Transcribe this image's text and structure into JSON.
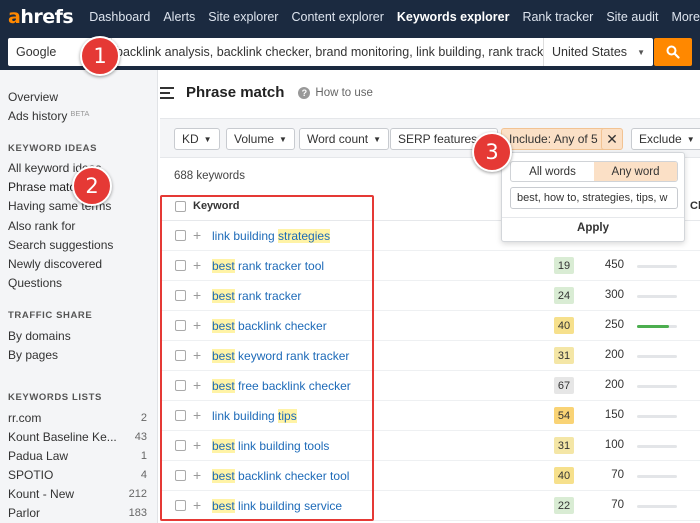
{
  "app": {
    "logo_a": "a",
    "logo_rest": "hrefs"
  },
  "nav": {
    "items": [
      "Dashboard",
      "Alerts",
      "Site explorer",
      "Content explorer",
      "Keywords explorer",
      "Rank tracker",
      "Site audit",
      "More"
    ],
    "active": "Keywords explorer"
  },
  "search": {
    "engine": "Google",
    "query": "backlink analysis, backlink checker, brand monitoring, link building, rank tracker, site au",
    "country": "United States",
    "button_icon": "search-icon"
  },
  "sidebar": {
    "top_items": [
      "Overview",
      "Ads history"
    ],
    "beta_label": "BETA",
    "keyword_ideas_heading": "KEYWORD IDEAS",
    "keyword_ideas": [
      "All keyword ideas",
      "Phrase match",
      "Having same terms",
      "Also rank for",
      "Search suggestions",
      "Newly discovered",
      "Questions"
    ],
    "traffic_share_heading": "TRAFFIC SHARE",
    "traffic_share": [
      "By domains",
      "By pages"
    ],
    "keywords_lists_heading": "KEYWORDS LISTS",
    "keywords_lists": [
      {
        "name": "rr.com",
        "count": "2"
      },
      {
        "name": "Kount Baseline Ke...",
        "count": "43"
      },
      {
        "name": "Padua Law",
        "count": "1"
      },
      {
        "name": "SPOTIO",
        "count": "4"
      },
      {
        "name": "Kount - New",
        "count": "212"
      },
      {
        "name": "Parlor",
        "count": "183"
      }
    ]
  },
  "page": {
    "title": "Phrase match",
    "how_to": "How to use"
  },
  "filters": {
    "kd": "KD",
    "volume": "Volume",
    "word_count": "Word count",
    "serp": "SERP features",
    "include": "Include: Any of 5",
    "include_clear": "✕",
    "exclude": "Exclude"
  },
  "keyword_count": "688 keywords",
  "table": {
    "keyword_header": "Keyword",
    "cl_header": "Cl",
    "rows": [
      {
        "pre": "",
        "hl": "",
        "mid": "link building ",
        "hl2": "strategies",
        "kd": "",
        "volume": "",
        "trend": 0
      },
      {
        "pre": "",
        "hl": "best",
        "mid": " rank tracker tool",
        "hl2": "",
        "kd": "19",
        "volume": "450",
        "trend": 0
      },
      {
        "pre": "",
        "hl": "best",
        "mid": " rank tracker",
        "hl2": "",
        "kd": "24",
        "volume": "300",
        "trend": 0
      },
      {
        "pre": "",
        "hl": "best",
        "mid": " backlink checker",
        "hl2": "",
        "kd": "40",
        "volume": "250",
        "trend": 0.8
      },
      {
        "pre": "",
        "hl": "best",
        "mid": " keyword rank tracker",
        "hl2": "",
        "kd": "31",
        "volume": "200",
        "trend": 0
      },
      {
        "pre": "",
        "hl": "best",
        "mid": " free backlink checker",
        "hl2": "",
        "kd": "67",
        "volume": "200",
        "trend": 0
      },
      {
        "pre": "",
        "hl": "",
        "mid": "link building ",
        "hl2": "tips",
        "kd": "54",
        "volume": "150",
        "trend": 0
      },
      {
        "pre": "",
        "hl": "best",
        "mid": " link building tools",
        "hl2": "",
        "kd": "31",
        "volume": "100",
        "trend": 0
      },
      {
        "pre": "",
        "hl": "best",
        "mid": " backlink checker tool",
        "hl2": "",
        "kd": "40",
        "volume": "70",
        "trend": 0
      },
      {
        "pre": "",
        "hl": "best",
        "mid": " link building service",
        "hl2": "",
        "kd": "22",
        "volume": "70",
        "trend": 0
      }
    ]
  },
  "popup": {
    "all_words": "All words",
    "any_word": "Any word",
    "selected": "Any word",
    "terms": "best, how to, strategies, tips, w",
    "apply": "Apply"
  },
  "badges": [
    "1",
    "2",
    "3"
  ],
  "colors": {
    "nav_bg": "#1b2a40",
    "accent": "#ff8800",
    "badge_red": "#e53935",
    "link": "#1d6ab8",
    "highlight": "#fff3a6"
  }
}
